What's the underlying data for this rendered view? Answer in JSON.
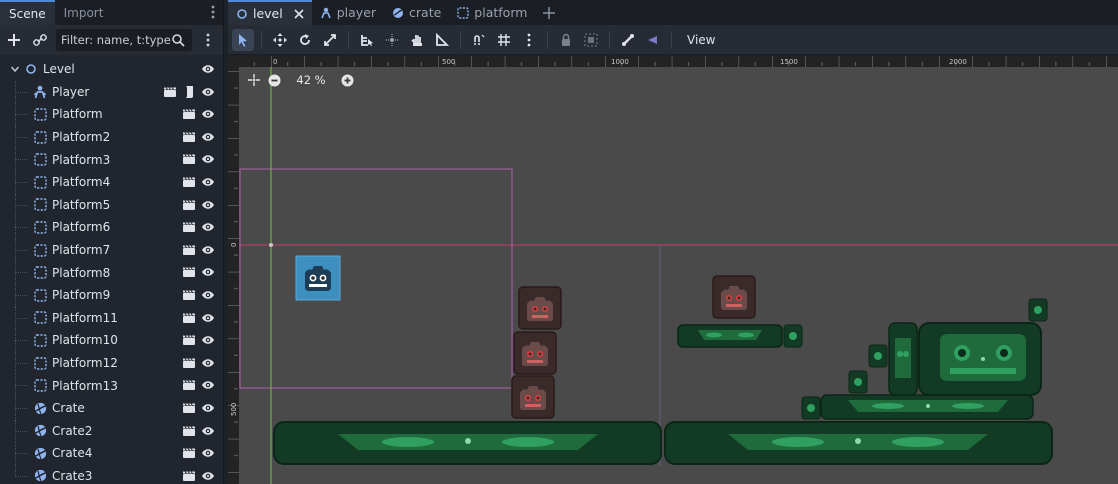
{
  "dock": {
    "tabs": [
      {
        "label": "Scene",
        "active": true
      },
      {
        "label": "Import",
        "active": false
      }
    ],
    "filter_placeholder": "Filter: name, t:type,",
    "tree": [
      {
        "label": "Level",
        "icon": "node2d-icon",
        "level": 0,
        "expanded": true
      },
      {
        "label": "Player",
        "icon": "character-icon",
        "level": 1,
        "has_script": true
      },
      {
        "label": "Platform",
        "icon": "static-body-icon",
        "level": 1
      },
      {
        "label": "Platform2",
        "icon": "static-body-icon",
        "level": 1
      },
      {
        "label": "Platform3",
        "icon": "static-body-icon",
        "level": 1
      },
      {
        "label": "Platform4",
        "icon": "static-body-icon",
        "level": 1
      },
      {
        "label": "Platform5",
        "icon": "static-body-icon",
        "level": 1
      },
      {
        "label": "Platform6",
        "icon": "static-body-icon",
        "level": 1
      },
      {
        "label": "Platform7",
        "icon": "static-body-icon",
        "level": 1
      },
      {
        "label": "Platform8",
        "icon": "static-body-icon",
        "level": 1
      },
      {
        "label": "Platform9",
        "icon": "static-body-icon",
        "level": 1
      },
      {
        "label": "Platform11",
        "icon": "static-body-icon",
        "level": 1
      },
      {
        "label": "Platform10",
        "icon": "static-body-icon",
        "level": 1
      },
      {
        "label": "Platform12",
        "icon": "static-body-icon",
        "level": 1
      },
      {
        "label": "Platform13",
        "icon": "static-body-icon",
        "level": 1
      },
      {
        "label": "Crate",
        "icon": "rigid-body-icon",
        "level": 1
      },
      {
        "label": "Crate2",
        "icon": "rigid-body-icon",
        "level": 1
      },
      {
        "label": "Crate4",
        "icon": "rigid-body-icon",
        "level": 1
      },
      {
        "label": "Crate3",
        "icon": "rigid-body-icon",
        "level": 1
      }
    ]
  },
  "scene_tabs": [
    {
      "label": "level",
      "icon": "node2d-icon",
      "active": true,
      "closable": true
    },
    {
      "label": "player",
      "icon": "character-icon",
      "active": false
    },
    {
      "label": "crate",
      "icon": "rigid-body-icon",
      "active": false
    },
    {
      "label": "platform",
      "icon": "static-body-icon",
      "active": false
    }
  ],
  "toolbar": {
    "view_label": "View"
  },
  "viewport": {
    "zoom": "42 %",
    "ruler_top": [
      "0",
      "500",
      "1000",
      "1500",
      "2000"
    ],
    "ruler_left": [
      "0",
      "500"
    ]
  },
  "colors": {
    "accent": "#4f8ad8",
    "viewport_bg": "#4a4a4a",
    "x_axis": "#c0406a",
    "y_axis": "#7bc043",
    "camera_rect": "#b060b0"
  }
}
